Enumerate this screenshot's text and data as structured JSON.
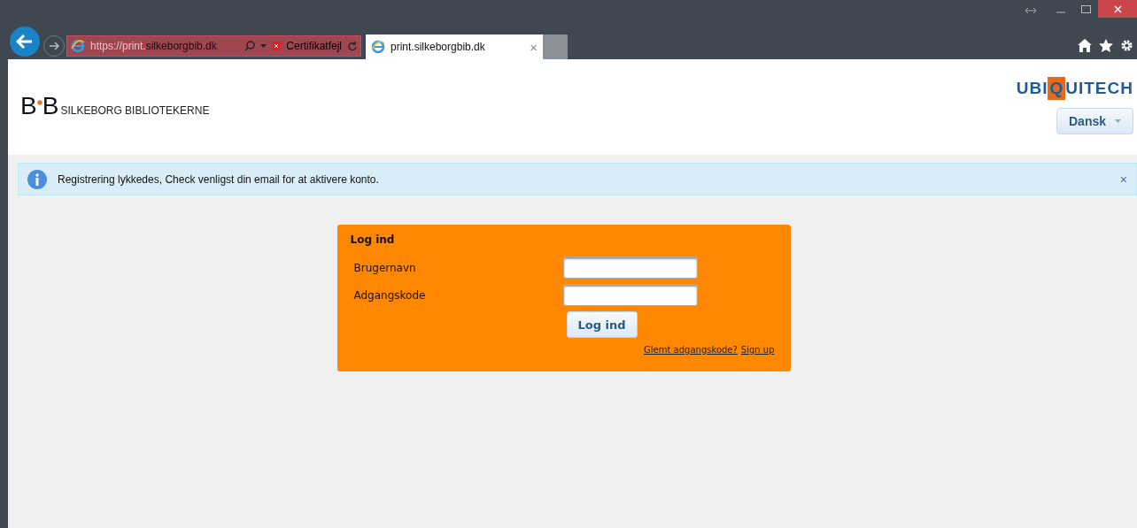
{
  "browser": {
    "address": {
      "prefix": "https://print.",
      "domain": "silkeborgbib.dk"
    },
    "certificate": "Certifikatfejl",
    "tabs": [
      {
        "title": "print.silkeborgbib.dk",
        "selected": true
      }
    ],
    "close_glyph": "×"
  },
  "header": {
    "logo": {
      "mark_left": "B",
      "mark_right": "B",
      "name": "SILKEBORG BIBLIOTEKERNE"
    },
    "vendor_logo": {
      "before": "UBI",
      "boxed": "Q",
      "after": "UITECH"
    },
    "language": "Dansk"
  },
  "alert": {
    "message": "Registrering lykkedes, Check venligst din email for at aktivere konto.",
    "close": "×"
  },
  "login": {
    "title": "Log ind",
    "fields": [
      {
        "label": "Brugernavn"
      },
      {
        "label": "Adgangskode"
      }
    ],
    "submit": "Log ind",
    "links": [
      "Glemt adgangskode?",
      "Sign up"
    ]
  }
}
